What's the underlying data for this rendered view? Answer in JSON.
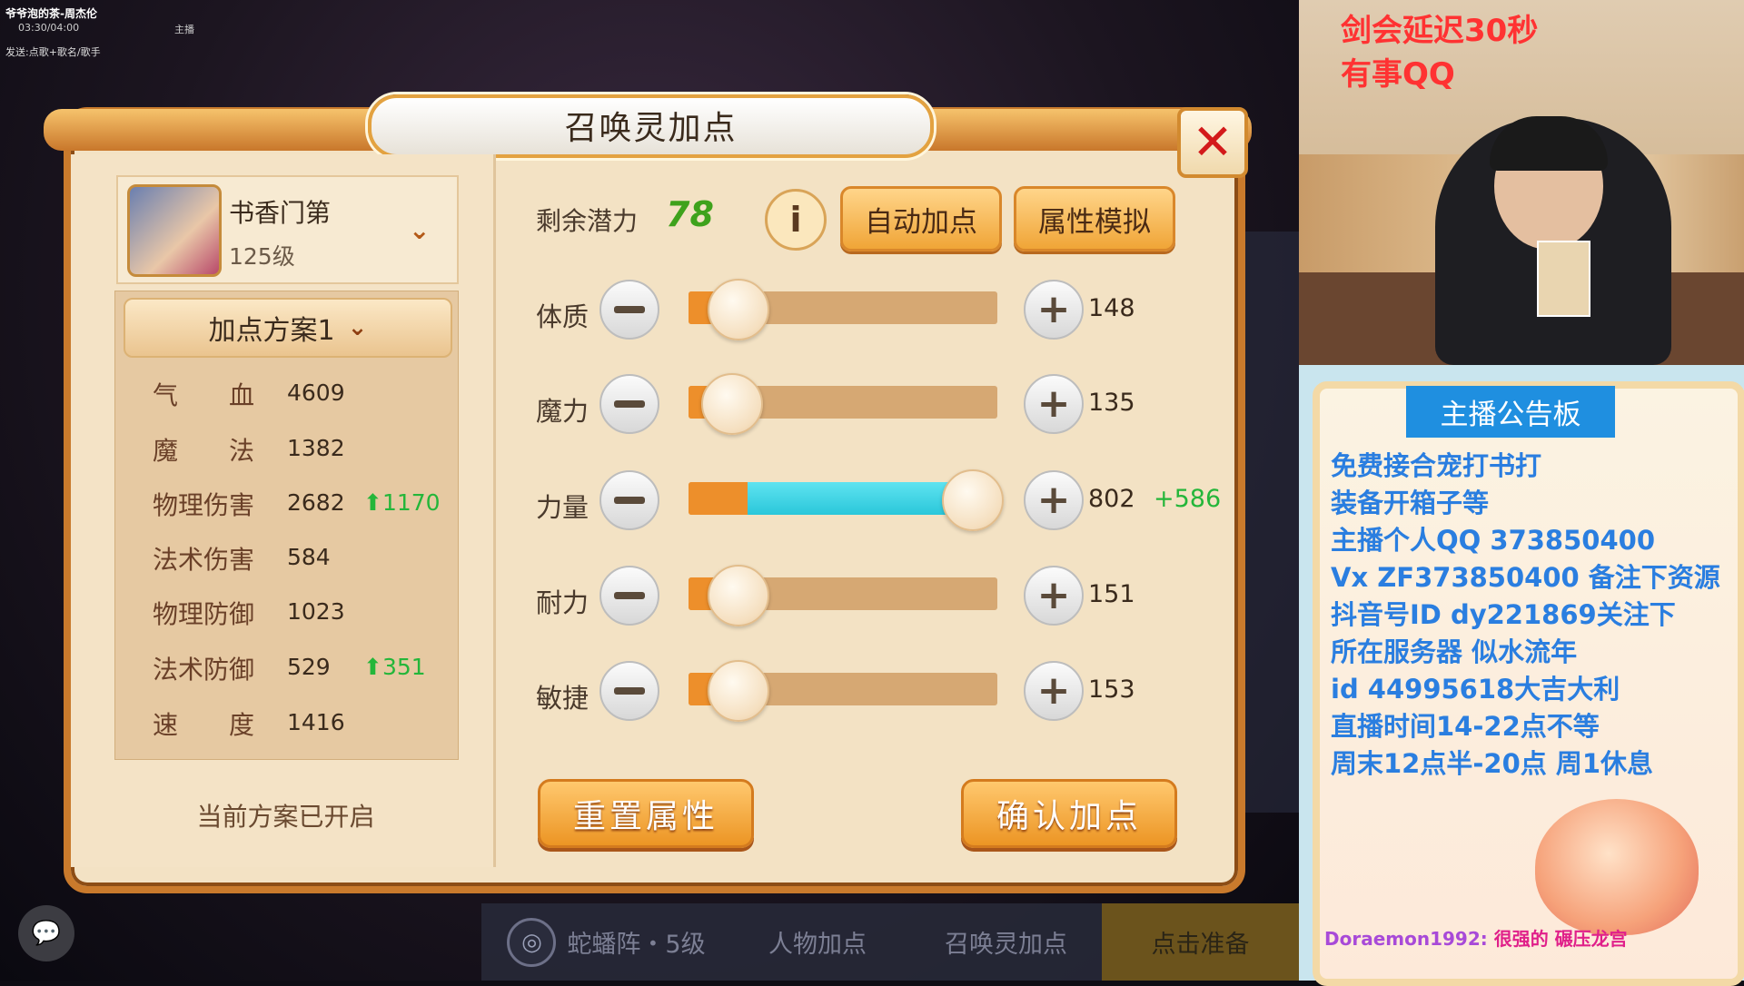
{
  "stream": {
    "song": "爷爷泡的茶-周杰伦",
    "time": "03:30/04:00",
    "host_tag": "主播",
    "send_hint": "发送:点歌+歌名/歌手",
    "delay_line1": "剑会延迟30秒",
    "delay_line2": "有事QQ"
  },
  "dialog": {
    "title": "召唤灵加点",
    "close_icon": "close-icon"
  },
  "pet": {
    "name": "书香门第",
    "level": "125级"
  },
  "plan": {
    "label": "加点方案1",
    "status": "当前方案已开启"
  },
  "stats": [
    {
      "label": "气　　血",
      "value": "4609",
      "bonus": ""
    },
    {
      "label": "魔　　法",
      "value": "1382",
      "bonus": ""
    },
    {
      "label": "物理伤害",
      "value": "2682",
      "bonus": "1170"
    },
    {
      "label": "法术伤害",
      "value": "584",
      "bonus": ""
    },
    {
      "label": "物理防御",
      "value": "1023",
      "bonus": ""
    },
    {
      "label": "法术防御",
      "value": "529",
      "bonus": "351"
    },
    {
      "label": "速　　度",
      "value": "1416",
      "bonus": ""
    }
  ],
  "potential": {
    "label": "剩余潜力",
    "value": "78"
  },
  "buttons": {
    "info_icon": "i",
    "auto_add": "自动加点",
    "simulate": "属性模拟",
    "reset": "重置属性",
    "confirm": "确认加点"
  },
  "attributes": [
    {
      "label": "体质",
      "value": "148",
      "bonus": "",
      "base_fraction": 0.15,
      "add_fraction": 0.0
    },
    {
      "label": "魔力",
      "value": "135",
      "bonus": "",
      "base_fraction": 0.13,
      "add_fraction": 0.0
    },
    {
      "label": "力量",
      "value": "802",
      "bonus": "+586",
      "base_fraction": 0.19,
      "add_fraction": 0.72
    },
    {
      "label": "耐力",
      "value": "151",
      "bonus": "",
      "base_fraction": 0.15,
      "add_fraction": 0.0
    },
    {
      "label": "敏捷",
      "value": "153",
      "bonus": "",
      "base_fraction": 0.15,
      "add_fraction": 0.0
    }
  ],
  "bottom_tabs": {
    "formation": "蛇蟠阵・5级",
    "char_points": "人物加点",
    "pet_points": "召唤灵加点",
    "ready": "点击准备"
  },
  "board": {
    "title": "主播公告板",
    "lines": [
      "免费接合宠打书打",
      "装备开箱子等",
      "主播个人QQ 373850400",
      "Vx ZF373850400 备注下资源",
      "抖音号ID dy221869关注下",
      "所在服务器 似水流年",
      "id 44995618大吉大利",
      "直播时间14-22点不等",
      "周末12点半-20点 周1休息"
    ],
    "danmu_user": "Doraemon1992:",
    "danmu_msg": "很强的 碾压龙宫"
  },
  "colors": {
    "accent_orange": "#ed8f2b",
    "bonus_green": "#24b63a",
    "add_cyan": "#2ac7da",
    "close_red": "#d31a1a",
    "board_blue": "#2a7ee0"
  }
}
